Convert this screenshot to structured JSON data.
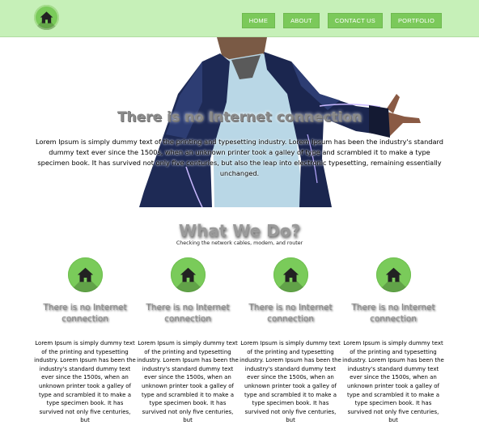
{
  "nav": {
    "items": [
      "HOME",
      "ABOUT",
      "CONTACT US",
      "PORTFOLIO"
    ]
  },
  "hero": {
    "title": "There is no Internet connection",
    "text": "Lorem Ipsum is simply dummy text of the printing and typesetting industry. Lorem Ipsum has been the industry's standard dummy text ever since the 1500s, when an unknown printer took a galley of type and scrambled it to make a type specimen book. It has survived not only five centuries, but also the leap into electronic typesetting, remaining essentially unchanged."
  },
  "services": {
    "title": "What We Do?",
    "subtitle": "Checking the network cables, modem, and router",
    "items": [
      {
        "title": "There is no Internet connection",
        "text": "Lorem Ipsum is simply dummy text of the printing and typesetting industry. Lorem Ipsum has been the industry's standard dummy text ever since the 1500s, when an unknown printer took a galley of type and scrambled it to make a type specimen book. It has survived not only five centuries, but"
      },
      {
        "title": "There is no Internet connection",
        "text": "Lorem Ipsum is simply dummy text of the printing and typesetting industry. Lorem Ipsum has been the industry's standard dummy text ever since the 1500s, when an unknown printer took a galley of type and scrambled it to make a type specimen book. It has survived not only five centuries, but"
      },
      {
        "title": "There is no Internet connection",
        "text": "Lorem Ipsum is simply dummy text of the printing and typesetting industry. Lorem Ipsum has been the industry's standard dummy text ever since the 1500s, when an unknown printer took a galley of type and scrambled it to make a type specimen book. It has survived not only five centuries, but"
      },
      {
        "title": "There is no Internet connection",
        "text": "Lorem Ipsum is simply dummy text of the printing and typesetting industry. Lorem Ipsum has been the industry's standard dummy text ever since the 1500s, when an unknown printer took a galley of type and scrambled it to make a type specimen book. It has survived not only five centuries, but"
      }
    ]
  },
  "icons": {
    "logo": "home-icon",
    "feature": "home-icon"
  },
  "colors": {
    "header_bg": "#c6f0b8",
    "accent": "#7bc95a"
  }
}
